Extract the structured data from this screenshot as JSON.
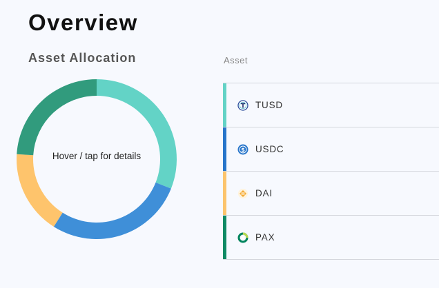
{
  "header": {
    "title": "Overview"
  },
  "allocation": {
    "title": "Asset Allocation",
    "hint": "Hover / tap for details",
    "column_header": "Asset"
  },
  "assets": [
    {
      "symbol": "TUSD",
      "color": "#63d3c6",
      "icon": "tusd-icon"
    },
    {
      "symbol": "USDC",
      "color": "#2775ca",
      "icon": "usdc-icon"
    },
    {
      "symbol": "DAI",
      "color": "#fcc46d",
      "icon": "dai-icon"
    },
    {
      "symbol": "PAX",
      "color": "#0f8a64",
      "icon": "pax-icon"
    }
  ],
  "chart_data": {
    "type": "pie",
    "style": "donut",
    "categories": [
      "TUSD",
      "USDC",
      "DAI",
      "PAX"
    ],
    "values": [
      31,
      28,
      17,
      24
    ],
    "colors": [
      "#63d3c6",
      "#3f8fd8",
      "#fec46c",
      "#319b7d"
    ]
  }
}
